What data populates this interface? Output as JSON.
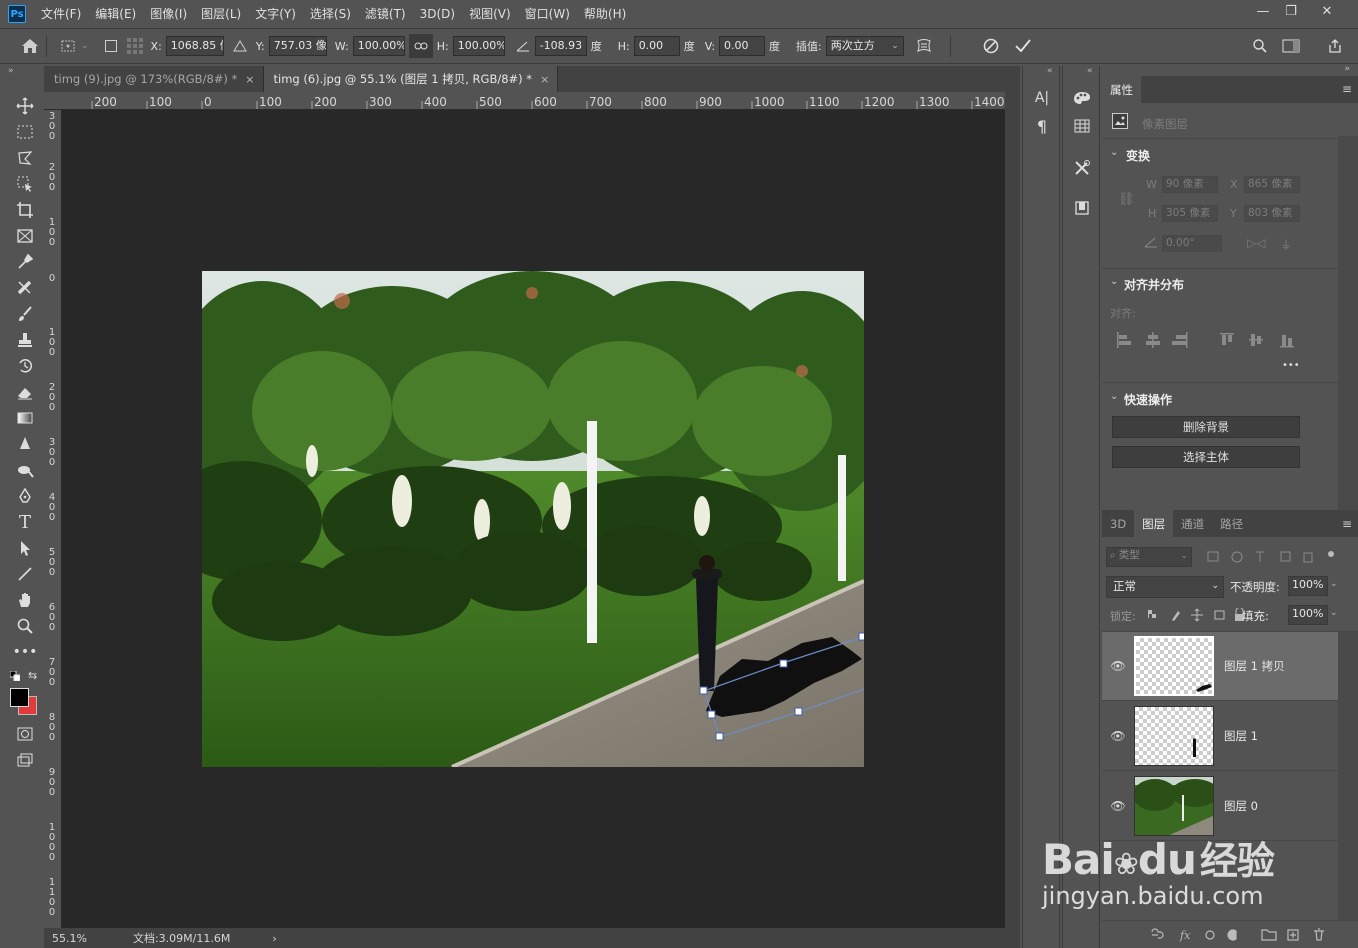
{
  "menubar": {
    "logo": "Ps",
    "items": [
      "文件(F)",
      "编辑(E)",
      "图像(I)",
      "图层(L)",
      "文字(Y)",
      "选择(S)",
      "滤镜(T)",
      "3D(D)",
      "视图(V)",
      "窗口(W)",
      "帮助(H)"
    ]
  },
  "options": {
    "x_label": "X:",
    "x_value": "1068.85 像",
    "y_label": "Y:",
    "y_value": "757.03 像素",
    "w_label": "W:",
    "w_value": "100.00%",
    "h_label": "H:",
    "h_value": "100.00%",
    "angle_value": "-108.93",
    "deg": "度",
    "hskew_label": "H:",
    "hskew_value": "0.00",
    "vskew_label": "V:",
    "vskew_value": "0.00",
    "interp_label": "插值:",
    "interp_value": "两次立方"
  },
  "tabs": [
    {
      "label": "timg (9).jpg @ 173%(RGB/8#) *",
      "close": "×"
    },
    {
      "label": "timg (6).jpg @ 55.1% (图层 1 拷贝, RGB/8#) *",
      "close": "×"
    }
  ],
  "ruler": {
    "h_labels": [
      "200",
      "100",
      "0",
      "100",
      "200",
      "300",
      "400",
      "500",
      "600",
      "700",
      "800",
      "900",
      "1000",
      "1100",
      "1200",
      "1300",
      "1400"
    ],
    "v_labels": [
      "300",
      "200",
      "100",
      "0",
      "100",
      "200",
      "300",
      "400",
      "500",
      "600",
      "700",
      "800",
      "900",
      "1000",
      "1100"
    ]
  },
  "status": {
    "zoom": "55.1%",
    "doc": "文档:3.09M/11.6M",
    "arrow": "›"
  },
  "properties": {
    "tab": "属性",
    "kind": "像素图层",
    "transform_title": "变换",
    "w_label": "W",
    "w_value": "90 像素",
    "x_label": "X",
    "x_value": "865 像素",
    "h_label": "H",
    "h_value": "305 像素",
    "y_label": "Y",
    "y_value": "803 像素",
    "angle_value": "0.00°",
    "align_title": "对齐并分布",
    "align_label": "对齐:",
    "more": "•••",
    "quick_title": "快速操作",
    "remove_bg": "删除背景",
    "select_subject": "选择主体"
  },
  "layers_panel": {
    "tabs": [
      "3D",
      "图层",
      "通道",
      "路径"
    ],
    "active_tab": "图层",
    "filter_label": "类型",
    "blend_mode": "正常",
    "opacity_label": "不透明度:",
    "opacity_value": "100%",
    "lock_label": "锁定:",
    "fill_label": "填充:",
    "fill_value": "100%",
    "layers": [
      {
        "name": "图层 1 拷贝",
        "selected": true
      },
      {
        "name": "图层 1",
        "selected": false
      },
      {
        "name": "图层 0",
        "selected": false
      }
    ]
  },
  "watermark": {
    "brand": "Bai",
    "brand_tail": "du",
    "cn": "经验",
    "url": "jingyan.baidu.com"
  },
  "colors": {
    "fg": "#000000",
    "bg": "#e03a3a",
    "accent": "#2fa3f3"
  }
}
